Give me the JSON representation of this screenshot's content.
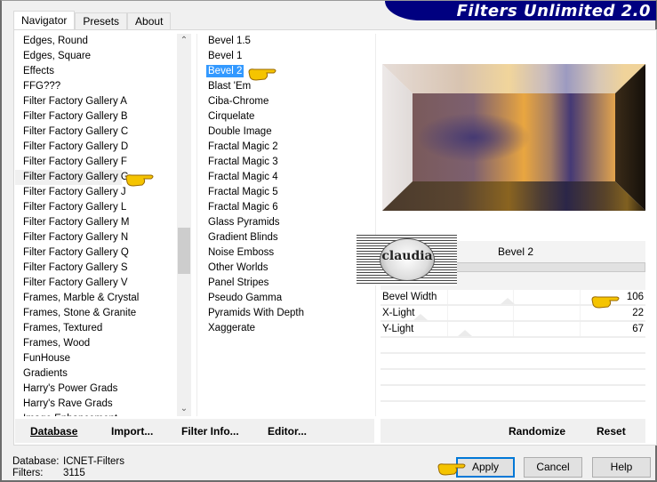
{
  "banner": {
    "title": "Filters Unlimited 2.0"
  },
  "tabs": [
    {
      "label": "Navigator",
      "active": true
    },
    {
      "label": "Presets",
      "active": false
    },
    {
      "label": "About",
      "active": false
    }
  ],
  "categories": {
    "items": [
      "Edges, Round",
      "Edges, Square",
      "Effects",
      "FFG???",
      "Filter Factory Gallery A",
      "Filter Factory Gallery B",
      "Filter Factory Gallery C",
      "Filter Factory Gallery D",
      "Filter Factory Gallery F",
      "Filter Factory Gallery G",
      "Filter Factory Gallery J",
      "Filter Factory Gallery L",
      "Filter Factory Gallery M",
      "Filter Factory Gallery N",
      "Filter Factory Gallery Q",
      "Filter Factory Gallery S",
      "Filter Factory Gallery V",
      "Frames, Marble & Crystal",
      "Frames, Stone & Granite",
      "Frames, Textured",
      "Frames, Wood",
      "FunHouse",
      "Gradients",
      "Harry's Power Grads",
      "Harry's Rave Grads",
      "Image Enhancement"
    ],
    "selected": "Filter Factory Gallery G"
  },
  "filters": {
    "items": [
      "Bevel 1.5",
      "Bevel 1",
      "Bevel 2",
      "Blast 'Em",
      "Ciba-Chrome",
      "Cirquelate",
      "Double Image",
      "Fractal Magic 2",
      "Fractal Magic 3",
      "Fractal Magic 4",
      "Fractal Magic 5",
      "Fractal Magic 6",
      "Glass Pyramids",
      "Gradient Blinds",
      "Noise Emboss",
      "Other Worlds",
      "Panel Stripes",
      "Pseudo Gamma",
      "Pyramids With Depth",
      "Xaggerate"
    ],
    "selected": "Bevel 2"
  },
  "params": {
    "title": "Bevel 2",
    "rows": [
      {
        "label": "Bevel Width",
        "value": "106",
        "fraction": 0.42
      },
      {
        "label": "X-Light",
        "value": "22",
        "fraction": 0.09
      },
      {
        "label": "Y-Light",
        "value": "67",
        "fraction": 0.26
      }
    ]
  },
  "watermark": {
    "text": "claudia"
  },
  "left_buttons": {
    "database": "Database",
    "import": "Import...",
    "filter_info": "Filter Info...",
    "editor": "Editor..."
  },
  "right_buttons": {
    "randomize": "Randomize",
    "reset": "Reset"
  },
  "status": {
    "database_label": "Database:",
    "database_value": "ICNET-Filters",
    "filters_label": "Filters:",
    "filters_value": "3115"
  },
  "dialog_buttons": {
    "apply": "Apply",
    "cancel": "Cancel",
    "help": "Help"
  },
  "colors": {
    "banner": "#000080",
    "selection": "#3399ff",
    "default_button_border": "#0078d7"
  }
}
